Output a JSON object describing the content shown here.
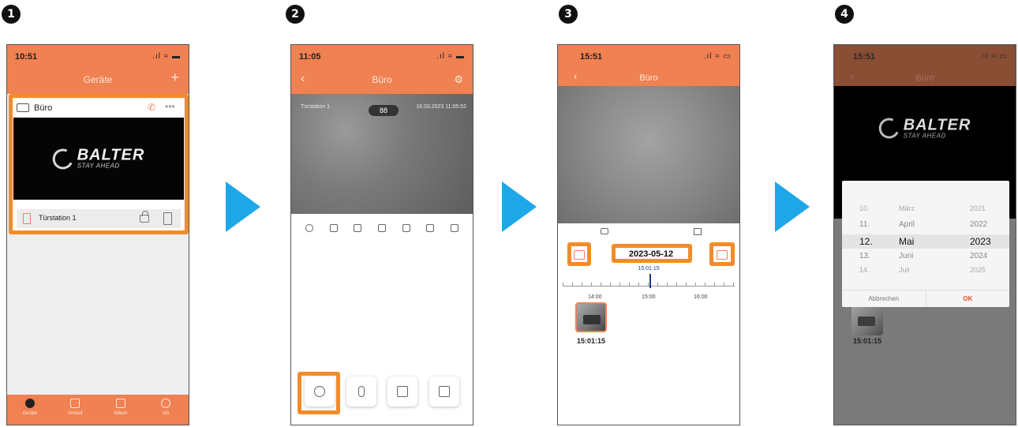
{
  "steps": [
    "1",
    "2",
    "3",
    "4"
  ],
  "colors": {
    "accent": "#f08152",
    "highlight": "#f28c2b",
    "arrow": "#1ea7e8"
  },
  "phone1": {
    "time": "10:51",
    "title": "Geräte",
    "add_icon": "plus-icon",
    "device_name": "Büro",
    "brand": "BALTER",
    "tagline": "STAY AHEAD",
    "station": "Türstation 1",
    "tabs": [
      {
        "label": "Geräte",
        "icon": "devices-icon"
      },
      {
        "label": "Verlauf",
        "icon": "history-icon"
      },
      {
        "label": "Album",
        "icon": "album-icon"
      },
      {
        "label": "Ich",
        "icon": "profile-icon"
      }
    ]
  },
  "phone2": {
    "time": "11:05",
    "title": "Büro",
    "camera_name": "Türstation 1",
    "counter": "88",
    "timestamp": "16.03.2023 11:05:52",
    "controls": [
      "record-icon",
      "mute-icon",
      "snapshot-icon",
      "subtitle-icon",
      "hd-icon",
      "crop-icon",
      "fullscreen-icon"
    ],
    "buttons": [
      "playback-icon",
      "microphone-icon",
      "unlock-icon",
      "keypad-icon"
    ]
  },
  "phone3": {
    "time": "15:51",
    "title": "Büro",
    "date": "2023-05-12",
    "cursor_time": "15:01:15",
    "hours": [
      "14:00",
      "15:00",
      "16:00"
    ],
    "clip_time": "15:01:15"
  },
  "phone4": {
    "time": "15:51",
    "title": "Büro",
    "brand": "BALTER",
    "tagline": "STAY AHEAD",
    "picker_rows": [
      {
        "d": "10.",
        "m": "März",
        "y": "2021"
      },
      {
        "d": "11.",
        "m": "April",
        "y": "2022"
      },
      {
        "d": "12.",
        "m": "Mai",
        "y": "2023"
      },
      {
        "d": "13.",
        "m": "Juni",
        "y": "2024"
      },
      {
        "d": "14.",
        "m": "Juli",
        "y": "2025"
      }
    ],
    "cancel": "Abbrechen",
    "ok": "OK",
    "clip_time": "15:01:15"
  }
}
